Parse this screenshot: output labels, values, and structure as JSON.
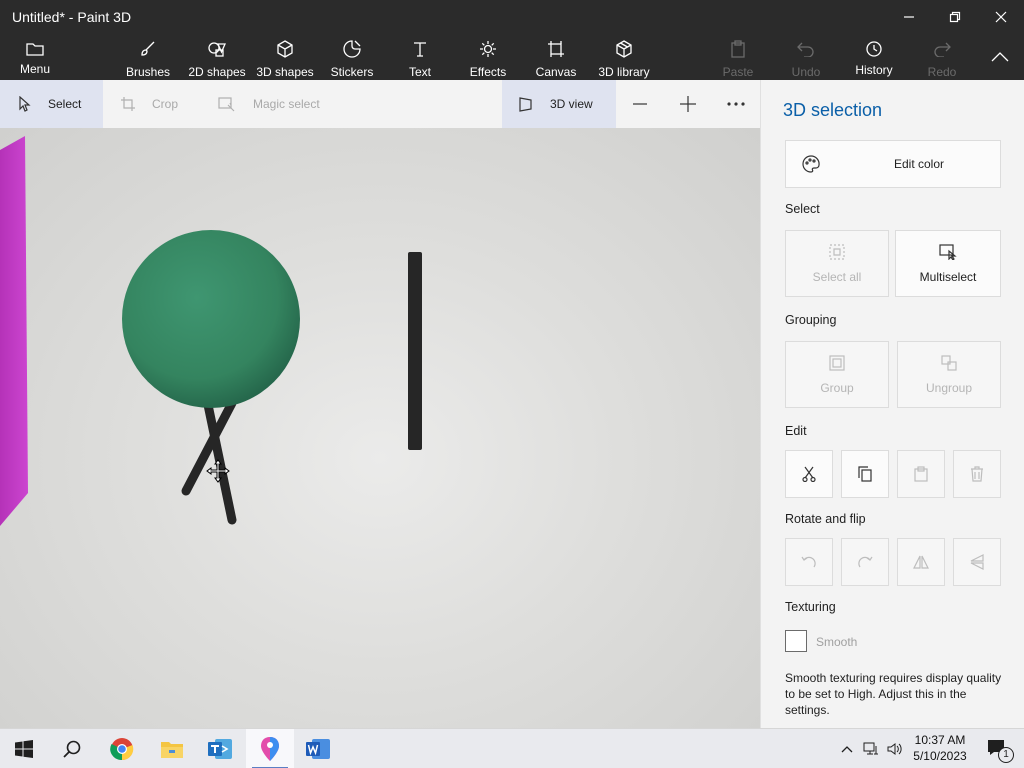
{
  "window": {
    "title": "Untitled* - Paint 3D"
  },
  "toolbar": {
    "menu": "Menu",
    "brushes": "Brushes",
    "shapes2d": "2D shapes",
    "shapes3d": "3D shapes",
    "stickers": "Stickers",
    "text": "Text",
    "effects": "Effects",
    "canvas": "Canvas",
    "library3d": "3D library",
    "paste": "Paste",
    "undo": "Undo",
    "history": "History",
    "redo": "Redo"
  },
  "subbar": {
    "select": "Select",
    "crop": "Crop",
    "magic_select": "Magic select",
    "view3d": "3D view"
  },
  "panel": {
    "title": "3D selection",
    "edit_color": "Edit color",
    "select_heading": "Select",
    "select_all": "Select all",
    "multiselect": "Multiselect",
    "grouping_heading": "Grouping",
    "group": "Group",
    "ungroup": "Ungroup",
    "edit_heading": "Edit",
    "rotate_heading": "Rotate and flip",
    "texturing_heading": "Texturing",
    "smooth": "Smooth",
    "smooth_note": "Smooth texturing requires display quality to be set to High. Adjust this in the settings."
  },
  "taskbar": {
    "time": "10:37 AM",
    "date": "5/10/2023",
    "notification_count": "1"
  },
  "colors": {
    "sphere": "#3a8a66",
    "magenta_shape": "#c73ecb",
    "title_accent": "#0a5fa8"
  }
}
